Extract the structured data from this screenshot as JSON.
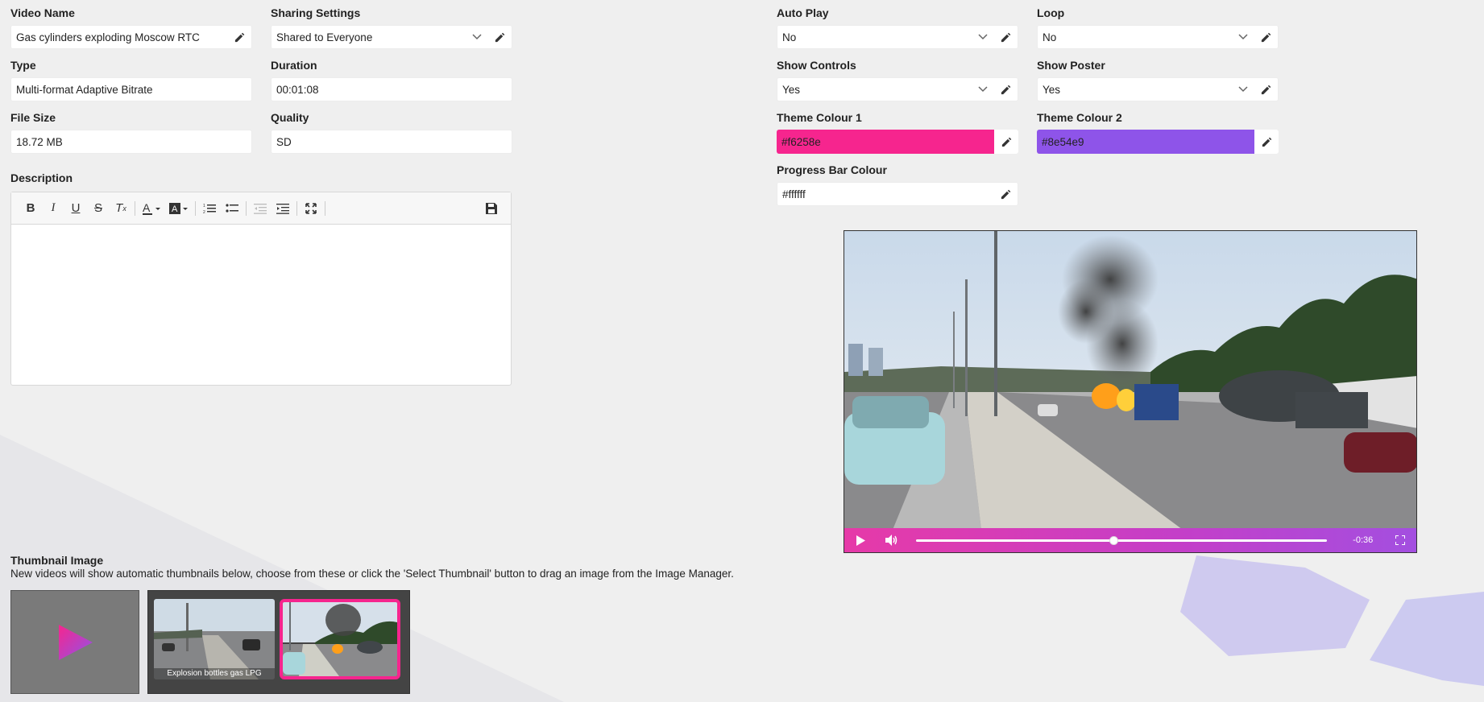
{
  "video_name": {
    "label": "Video Name",
    "value": "Gas cylinders exploding Moscow RTC"
  },
  "sharing": {
    "label": "Sharing Settings",
    "value": "Shared to Everyone"
  },
  "type": {
    "label": "Type",
    "value": "Multi-format Adaptive Bitrate"
  },
  "duration": {
    "label": "Duration",
    "value": "00:01:08"
  },
  "file_size": {
    "label": "File Size",
    "value": "18.72 MB"
  },
  "quality": {
    "label": "Quality",
    "value": "SD"
  },
  "description": {
    "label": "Description"
  },
  "auto_play": {
    "label": "Auto Play",
    "value": "No"
  },
  "loop": {
    "label": "Loop",
    "value": "No"
  },
  "show_controls": {
    "label": "Show Controls",
    "value": "Yes"
  },
  "show_poster": {
    "label": "Show Poster",
    "value": "Yes"
  },
  "theme1": {
    "label": "Theme Colour 1",
    "value": "#f6258e",
    "color": "#f6258e"
  },
  "theme2": {
    "label": "Theme Colour 2",
    "value": "#8e54e9",
    "color": "#8e54e9"
  },
  "progress": {
    "label": "Progress Bar Colour",
    "value": "#ffffff"
  },
  "player": {
    "time_remaining": "-0:36",
    "played_fraction": 0.48
  },
  "thumbnail": {
    "title": "Thumbnail Image",
    "description": "New videos will show automatic thumbnails below, choose from these or click the 'Select Thumbnail' button to drag an image from the Image Manager.",
    "thumb1_caption": "Explosion bottles gas LPG"
  },
  "icons": {
    "edit": "pencil-icon",
    "dropdown": "chevron-down-icon",
    "save": "floppy-disk-icon",
    "play": "play-icon",
    "volume": "volume-icon",
    "fullscreen": "fullscreen-icon"
  }
}
